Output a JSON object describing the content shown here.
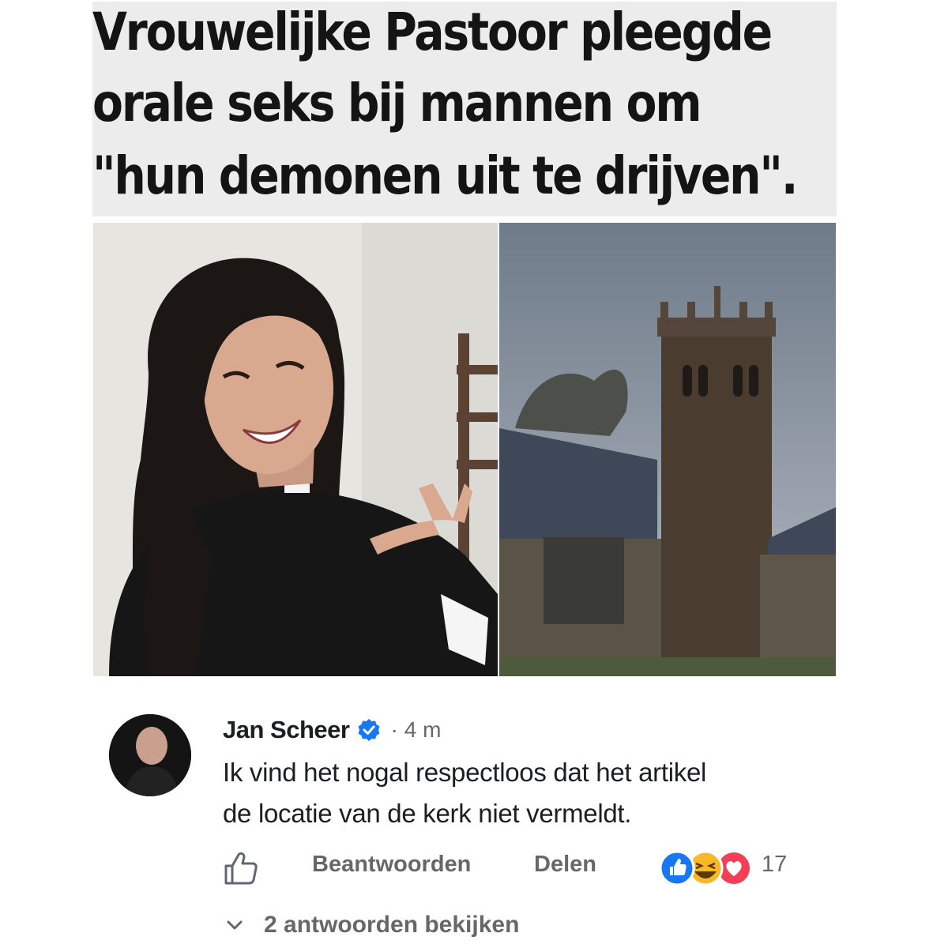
{
  "headline": {
    "lines": [
      "Vrouwelijke Pastoor pleegde",
      "orale seks bij mannen om",
      "\"hun demonen uit te drijven\"."
    ]
  },
  "images": {
    "left": "photo-pastor",
    "right": "photo-church"
  },
  "comment": {
    "author": "Jan Scheer",
    "separator": "·",
    "timestamp": "4 m",
    "text_line1": "Ik vind het nogal respectloos dat het artikel",
    "text_line2": "de locatie van de kerk niet vermeldt.",
    "actions": {
      "reply_label": "Beantwoorden",
      "share_label": "Delen",
      "reaction_count": "17"
    },
    "view_replies_label": "2 antwoorden bekijken"
  },
  "colors": {
    "headline_bg": "#ececec",
    "verified_blue": "#1877f2",
    "muted_text": "#65676b",
    "reaction_like": "#1877f2",
    "reaction_haha": "#f7b928",
    "reaction_love": "#f33e58"
  }
}
